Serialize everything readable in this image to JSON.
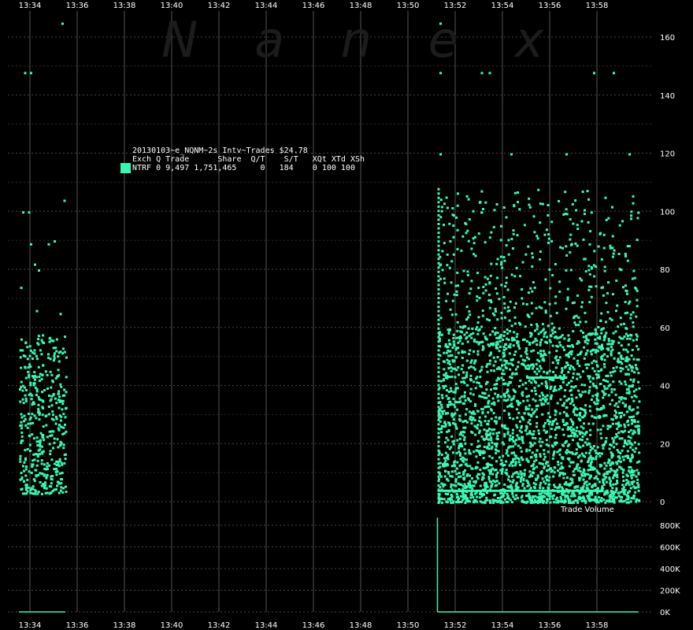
{
  "watermark": "Nanex",
  "legend": {
    "title": "20130103~e_NQNM~2s Intv~Trades $24.78",
    "header": "Exch Q Trade      Share  Q/T    S/T   XQt XTd XSh",
    "row": "NTRF 0 9,497 1,751,465     0   184    0 100 100",
    "swatch_color": "#3cf7b4"
  },
  "volume_label": "Trade Volume",
  "chart_data": [
    {
      "type": "scatter",
      "panel": "price",
      "time_ticks": [
        "13:34",
        "13:36",
        "13:38",
        "13:40",
        "13:42",
        "13:44",
        "13:46",
        "13:48",
        "13:50",
        "13:52",
        "13:54",
        "13:56",
        "13:58"
      ],
      "ylim": [
        0,
        165
      ],
      "yticks": [
        "0",
        "20",
        "40",
        "60",
        "80",
        "100",
        "120",
        "140",
        "160"
      ],
      "series_color": "#3cf7b4",
      "clusters": [
        {
          "x_start": "13:33:32",
          "x_end": "13:35:30",
          "dense_y_range": [
            3,
            58
          ],
          "sparse_points": [
            [
              "13:33:40",
              100
            ],
            [
              "13:33:55",
              100
            ],
            [
              "13:34:00",
              89
            ],
            [
              "13:34:10",
              82
            ],
            [
              "13:34:20",
              80
            ],
            [
              "13:34:45",
              89
            ],
            [
              "13:35:00",
              90
            ],
            [
              "13:35:25",
              104
            ],
            [
              "13:35:20",
              165
            ],
            [
              "13:33:45",
              148
            ],
            [
              "13:34:00",
              148
            ],
            [
              "13:33:35",
              74
            ],
            [
              "13:34:15",
              66
            ],
            [
              "13:35:15",
              65
            ]
          ]
        },
        {
          "x_start": "13:51:15",
          "x_end": "13:59:45",
          "dense_y_range": [
            0,
            60
          ],
          "sparse_points": [
            [
              "13:51:20",
              165
            ],
            [
              "13:51:20",
              148
            ],
            [
              "13:53:05",
              148
            ],
            [
              "13:53:25",
              148
            ],
            [
              "13:57:50",
              148
            ],
            [
              "13:58:40",
              148
            ],
            [
              "13:51:20",
              120
            ],
            [
              "13:54:20",
              120
            ],
            [
              "13:56:40",
              120
            ],
            [
              "13:59:20",
              120
            ]
          ]
        }
      ],
      "notable_levels": [
        4,
        43
      ]
    },
    {
      "type": "bar",
      "panel": "volume",
      "ylabel": "Trade Volume",
      "ylim": [
        0,
        900000
      ],
      "yticks": [
        "0K",
        "200K",
        "400K",
        "600K",
        "800K"
      ],
      "spike": {
        "time": "13:51:15",
        "value": 870000
      }
    }
  ]
}
